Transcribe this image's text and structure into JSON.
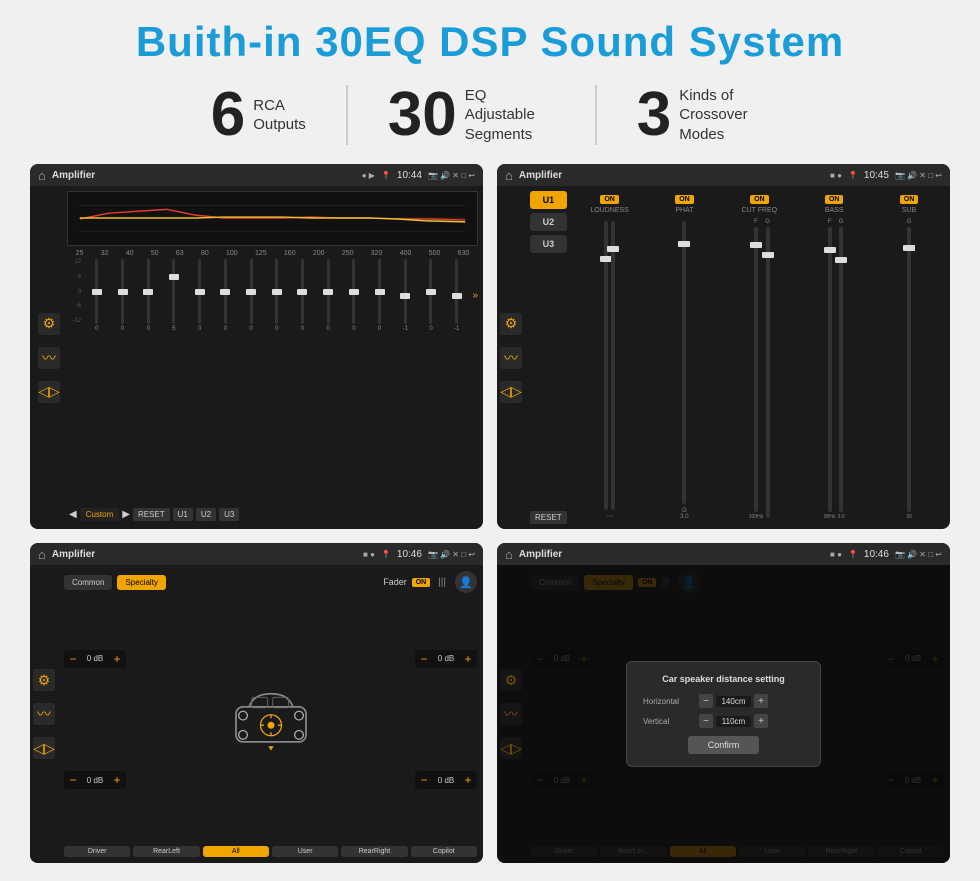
{
  "title": "Buith-in 30EQ DSP Sound System",
  "stats": [
    {
      "number": "6",
      "label": "RCA\nOutputs"
    },
    {
      "number": "30",
      "label": "EQ Adjustable\nSegments"
    },
    {
      "number": "3",
      "label": "Kinds of\nCrossover Modes"
    }
  ],
  "screens": [
    {
      "id": "screen1",
      "status_bar": {
        "title": "Amplifier",
        "time": "10:44"
      },
      "type": "eq"
    },
    {
      "id": "screen2",
      "status_bar": {
        "title": "Amplifier",
        "time": "10:45"
      },
      "type": "amp"
    },
    {
      "id": "screen3",
      "status_bar": {
        "title": "Amplifier",
        "time": "10:46"
      },
      "type": "fader"
    },
    {
      "id": "screen4",
      "status_bar": {
        "title": "Amplifier",
        "time": "10:46"
      },
      "type": "dialog"
    }
  ],
  "eq": {
    "frequencies": [
      "25",
      "32",
      "40",
      "50",
      "63",
      "80",
      "100",
      "125",
      "160",
      "200",
      "250",
      "320",
      "400",
      "500",
      "630"
    ],
    "values": [
      "0",
      "0",
      "0",
      "5",
      "0",
      "0",
      "0",
      "0",
      "0",
      "0",
      "0",
      "0",
      "-1",
      "0",
      "-1"
    ],
    "preset": "Custom",
    "buttons": [
      "RESET",
      "U1",
      "U2",
      "U3"
    ]
  },
  "amp": {
    "u_buttons": [
      "U1",
      "U2",
      "U3"
    ],
    "panels": [
      {
        "title": "LOUDNESS",
        "on": true
      },
      {
        "title": "PHAT",
        "on": true
      },
      {
        "title": "CUT FREQ",
        "on": true
      },
      {
        "title": "BASS",
        "on": true
      },
      {
        "title": "SUB",
        "on": true
      }
    ],
    "reset_label": "RESET"
  },
  "fader": {
    "tabs": [
      "Common",
      "Specialty"
    ],
    "fader_label": "Fader",
    "on_badge": "ON",
    "db_values": [
      "0 dB",
      "0 dB",
      "0 dB",
      "0 dB"
    ],
    "bottom_buttons": [
      "Driver",
      "RearLeft",
      "All",
      "User",
      "RearRight",
      "Copilot"
    ]
  },
  "dialog": {
    "title": "Car speaker distance setting",
    "horizontal_label": "Horizontal",
    "horizontal_value": "140cm",
    "vertical_label": "Vertical",
    "vertical_value": "110cm",
    "confirm_label": "Confirm",
    "db_values": [
      "0 dB",
      "0 dB"
    ],
    "bottom_buttons": [
      "Driver",
      "RearLef...",
      "All",
      "User",
      "RearRight",
      "Copilot"
    ]
  }
}
